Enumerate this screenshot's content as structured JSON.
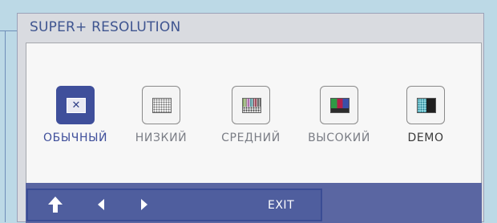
{
  "osd": {
    "title": "SUPER+ RESOLUTION",
    "options": [
      {
        "label": "ОБЫЧНЫЙ",
        "icon": "off-x-icon",
        "selected": true
      },
      {
        "label": "НИЗКИЙ",
        "icon": "low-resolution-icon",
        "selected": false
      },
      {
        "label": "СРЕДНИЙ",
        "icon": "middle-resolution-icon",
        "selected": false
      },
      {
        "label": "ВЫСОКИЙ",
        "icon": "high-resolution-icon",
        "selected": false
      },
      {
        "label": "DEMO",
        "icon": "demo-split-icon",
        "selected": false
      }
    ],
    "footer": {
      "up_icon": "up-arrow-icon",
      "left_icon": "left-arrow-icon",
      "right_icon": "right-arrow-icon",
      "exit_label": "EXIT"
    }
  },
  "colors": {
    "selected_accent": "#3f4f9b",
    "footer_bg": "#5a66a2",
    "title_text": "#3f5590",
    "panel_bg": "#d9dbe0",
    "backdrop": "#bcd9e6"
  }
}
